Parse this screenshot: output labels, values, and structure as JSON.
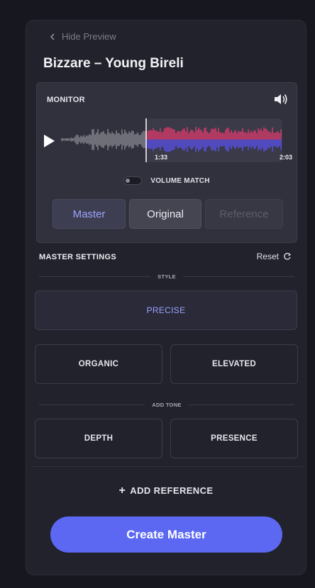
{
  "header": {
    "hide_preview_label": "Hide Preview",
    "track_title": "Bizzare – Young Bireli"
  },
  "monitor": {
    "label": "MONITOR",
    "current_time": "1:33",
    "total_time": "2:03",
    "playhead_fraction": 0.756,
    "volume_match_label": "VOLUME MATCH",
    "volume_match_on": false,
    "segments": [
      {
        "label": "Master",
        "state": "selected"
      },
      {
        "label": "Original",
        "state": "default"
      },
      {
        "label": "Reference",
        "state": "disabled"
      }
    ]
  },
  "settings": {
    "title": "MASTER SETTINGS",
    "reset_label": "Reset",
    "style_label": "STYLE",
    "style_options": [
      "PRECISE",
      "ORGANIC",
      "ELEVATED"
    ],
    "selected_style": "PRECISE",
    "tone_label": "ADD TONE",
    "tone_options": [
      "DEPTH",
      "PRESENCE"
    ]
  },
  "footer": {
    "add_reference_label": "ADD REFERENCE",
    "create_master_label": "Create Master"
  },
  "colors": {
    "accent": "#5c68f2",
    "accent_text": "#9ba3ff",
    "wave_played": "#8a8a92",
    "wave_upper": "#e23a6e",
    "wave_lower": "#5b52f0"
  }
}
